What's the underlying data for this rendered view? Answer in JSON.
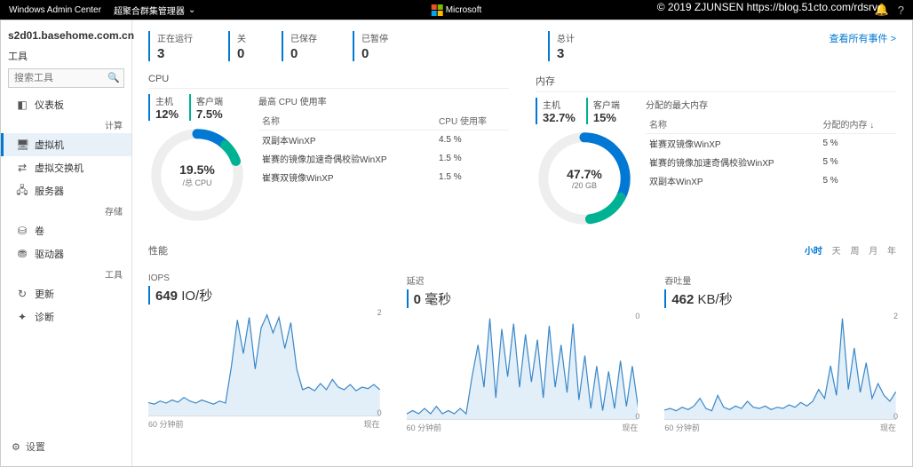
{
  "topbar": {
    "wac": "Windows Admin Center",
    "breadcrumb": "超聚合群集管理器",
    "ms": "Microsoft",
    "notif": "🔔",
    "help": "?",
    "chev": "⌄"
  },
  "watermark": "© 2019 ZJUNSEN https://blog.51cto.com/rdsrv",
  "sidebar": {
    "server": "s2d01.basehome.com.cn",
    "tools": "工具",
    "search_ph": "搜索工具",
    "groups": [
      "计算",
      "存储",
      "工具"
    ],
    "items": [
      {
        "icon": "◧",
        "label": "仪表板"
      },
      {
        "icon": "🖥",
        "label": "虚拟机"
      },
      {
        "icon": "⇄",
        "label": "虚拟交换机"
      },
      {
        "icon": "🖧",
        "label": "服务器"
      },
      {
        "icon": "⛁",
        "label": "卷"
      },
      {
        "icon": "⛃",
        "label": "驱动器"
      },
      {
        "icon": "↻",
        "label": "更新"
      },
      {
        "icon": "✦",
        "label": "诊断"
      }
    ],
    "settings": {
      "icon": "⚙",
      "label": "设置"
    }
  },
  "stats": [
    {
      "label": "正在运行",
      "value": "3"
    },
    {
      "label": "关",
      "value": "0"
    },
    {
      "label": "已保存",
      "value": "0"
    },
    {
      "label": "已暂停",
      "value": "0"
    }
  ],
  "total": {
    "label": "总计",
    "value": "3"
  },
  "events_link": "查看所有事件 >",
  "cpu": {
    "title": "CPU",
    "host": {
      "label": "主机",
      "value": "12%"
    },
    "guest": {
      "label": "客户端",
      "value": "7.5%"
    },
    "center": "19.5%",
    "unit": "/总 CPU",
    "table": {
      "title": "最高 CPU 使用率",
      "h1": "名称",
      "h2": "CPU 使用率",
      "rows": [
        {
          "n": "双副本WinXP",
          "v": "4.5 %"
        },
        {
          "n": "崔赛的镜像加速奇偶校验WinXP",
          "v": "1.5 %"
        },
        {
          "n": "崔赛双镜像WinXP",
          "v": "1.5 %"
        }
      ]
    }
  },
  "mem": {
    "title": "内存",
    "host": {
      "label": "主机",
      "value": "32.7%"
    },
    "guest": {
      "label": "客户端",
      "value": "15%"
    },
    "center": "47.7%",
    "unit": "/20 GB",
    "table": {
      "title": "分配的最大内存",
      "h1": "名称",
      "h2": "分配的内存 ↓",
      "rows": [
        {
          "n": "崔赛双镜像WinXP",
          "v": "5 %"
        },
        {
          "n": "崔赛的镜像加速奇偶校验WinXP",
          "v": "5 %"
        },
        {
          "n": "双副本WinXP",
          "v": "5 %"
        }
      ]
    }
  },
  "perf": {
    "title": "性能",
    "ranges": [
      "小时",
      "天",
      "周",
      "月",
      "年"
    ],
    "active": "小时"
  },
  "charts": [
    {
      "title": "IOPS",
      "value": "649",
      "unit": " IO/秒",
      "xl": "60 分钟前",
      "xr": "现在",
      "ymax": "2"
    },
    {
      "title": "延迟",
      "value": "0",
      "unit": " 毫秒",
      "xl": "60 分钟前",
      "xr": "现在",
      "ymax": "0"
    },
    {
      "title": "吞吐量",
      "value": "462",
      "unit": " KB/秒",
      "xl": "60 分钟前",
      "xr": "现在",
      "ymax": "2"
    }
  ],
  "chart_data": [
    {
      "type": "area",
      "title": "IOPS",
      "ylabel": "IO/秒",
      "ylim": [
        0,
        2
      ],
      "xlabel": "60 分钟前 → 现在",
      "values": [
        0.25,
        0.22,
        0.28,
        0.24,
        0.3,
        0.26,
        0.35,
        0.28,
        0.24,
        0.3,
        0.26,
        0.22,
        0.28,
        0.24,
        0.95,
        1.85,
        1.2,
        1.9,
        0.9,
        1.7,
        1.95,
        1.6,
        1.9,
        1.3,
        1.8,
        0.9,
        0.5,
        0.55,
        0.48,
        0.62,
        0.5,
        0.7,
        0.55,
        0.5,
        0.6,
        0.48,
        0.55,
        0.52,
        0.6,
        0.5
      ]
    },
    {
      "type": "area",
      "title": "延迟",
      "ylabel": "毫秒",
      "ylim": [
        0,
        1
      ],
      "xlabel": "60 分钟前 → 现在",
      "values": [
        0.05,
        0.08,
        0.05,
        0.1,
        0.05,
        0.12,
        0.05,
        0.08,
        0.05,
        0.1,
        0.05,
        0.4,
        0.7,
        0.3,
        0.95,
        0.2,
        0.85,
        0.4,
        0.9,
        0.3,
        0.8,
        0.35,
        0.75,
        0.2,
        0.88,
        0.3,
        0.7,
        0.25,
        0.9,
        0.18,
        0.6,
        0.1,
        0.5,
        0.08,
        0.45,
        0.1,
        0.55,
        0.12,
        0.5,
        0.1
      ]
    },
    {
      "type": "area",
      "title": "吞吐量",
      "ylabel": "KB/秒",
      "ylim": [
        0,
        2
      ],
      "xlabel": "60 分钟前 → 现在",
      "values": [
        0.15,
        0.18,
        0.14,
        0.2,
        0.16,
        0.22,
        0.35,
        0.18,
        0.14,
        0.4,
        0.2,
        0.16,
        0.22,
        0.18,
        0.3,
        0.2,
        0.18,
        0.22,
        0.16,
        0.2,
        0.18,
        0.24,
        0.2,
        0.28,
        0.22,
        0.3,
        0.5,
        0.35,
        0.9,
        0.4,
        1.7,
        0.5,
        1.2,
        0.45,
        0.95,
        0.35,
        0.6,
        0.4,
        0.3,
        0.46
      ]
    }
  ]
}
